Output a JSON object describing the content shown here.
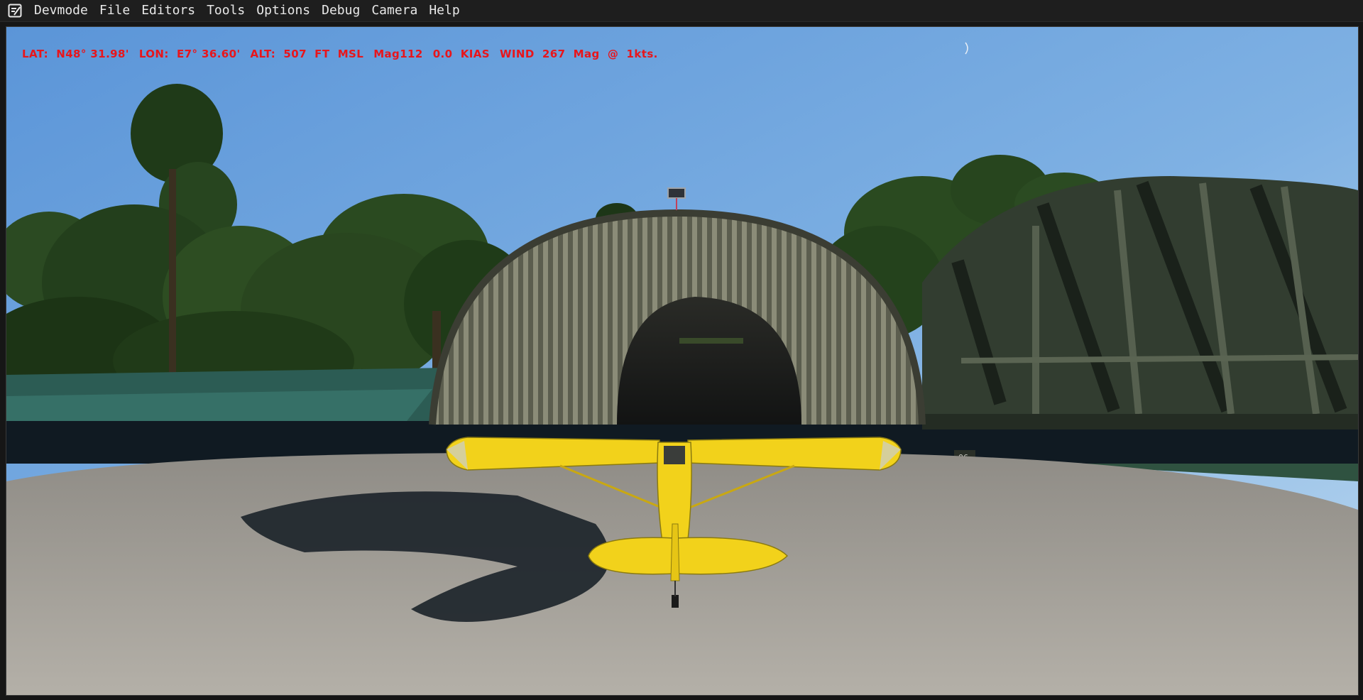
{
  "menubar": {
    "items": [
      "Devmode",
      "File",
      "Editors",
      "Tools",
      "Options",
      "Debug",
      "Camera",
      "Help"
    ]
  },
  "hud": {
    "lat": "LAT:  N48° 31.98'",
    "lon": "LON:  E7° 36.60'",
    "alt": "ALT:  507  FT  MSL",
    "heading": "Mag112",
    "airspeed": "0.0  KIAS",
    "wind": "WIND  267  Mag  @  1kts."
  },
  "scene": {
    "hangar_number": "06",
    "colors": {
      "sky_top": "#5b95d8",
      "sky_bottom": "#bcd8ef",
      "aircraft": "#f2d21b",
      "hud_text": "#e8151b",
      "hangar_right": "#323d30",
      "tarmac": "#a39f98"
    }
  }
}
